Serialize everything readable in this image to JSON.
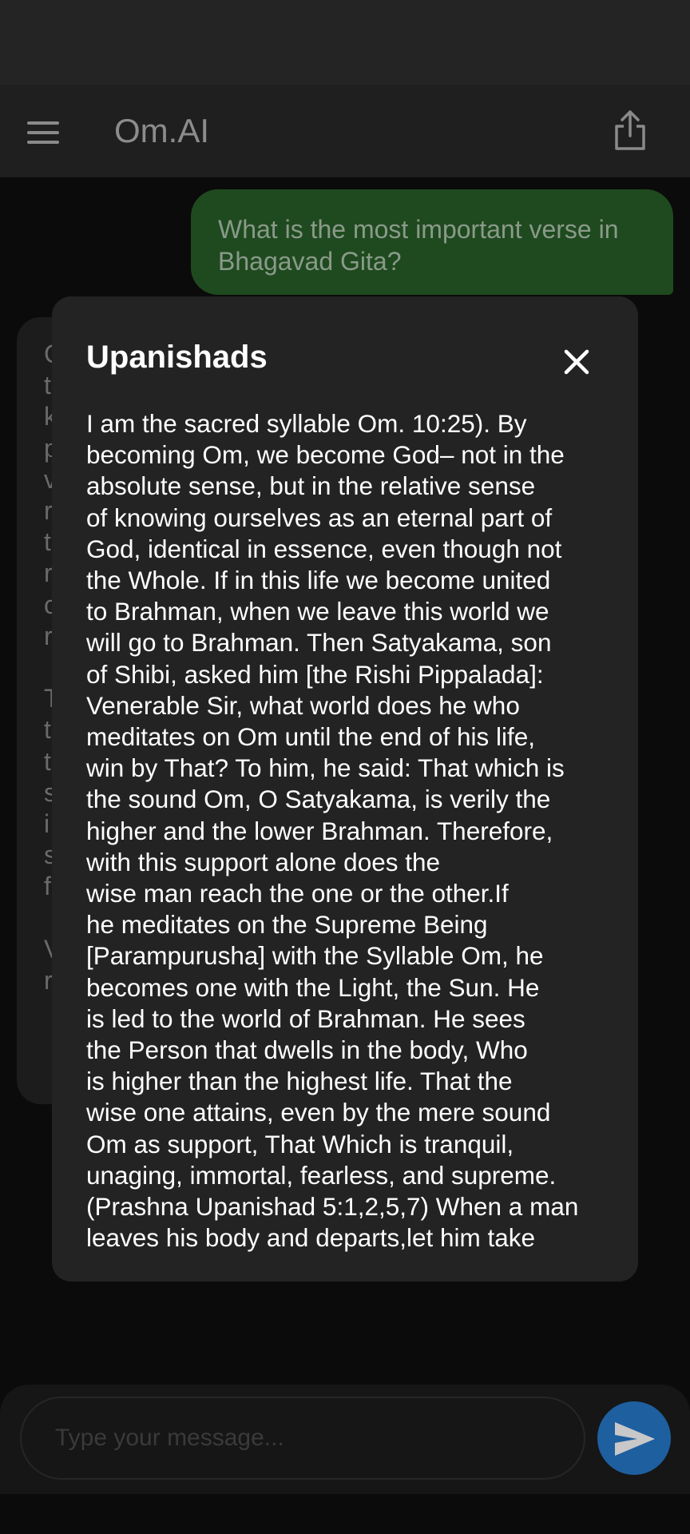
{
  "app": {
    "title": "Om.AI"
  },
  "chat": {
    "user_message": "What is the most important verse in Bhagavad Gita?",
    "bot_peek_letters": [
      "C",
      "t",
      "k",
      "p",
      "v",
      "r",
      "t",
      "r",
      "c",
      "r",
      "",
      "T",
      "t",
      "t",
      "s",
      "i",
      "s",
      "f",
      "",
      "V",
      "r"
    ]
  },
  "modal": {
    "title": "Upanishads",
    "body": "I am the sacred syllable Om. 10:25). By\nbecoming Om, we become God– not in the\nabsolute sense, but in the relative sense\nof knowing ourselves as an eternal part of\nGod, identical in essence, even though not\nthe Whole. If in this life we become united\nto Brahman, when we leave this world we\nwill go to Brahman. Then Satyakama, son\nof Shibi, asked him [the Rishi Pippalada]:\nVenerable Sir, what world does he who\nmeditates on Om until the end of his life,\nwin by That? To him, he said: That which is\nthe sound Om, O Satyakama, is verily the\nhigher and the lower Brahman. Therefore,\nwith this support alone does the\nwise man reach the one or the other.If\nhe meditates on the Supreme Being\n[Parampurusha] with the Syllable Om, he\nbecomes one with the Light, the Sun. He\nis led to the world of Brahman. He sees\nthe Person that dwells in the body, Who\nis higher than the highest life. That the\nwise one attains, even by the mere sound\nOm as support, That Which is tranquil,\nunaging, immortal, fearless, and supreme.\n(Prashna Upanishad 5:1,2,5,7) When a man\nleaves his body and departs,let him take"
  },
  "composer": {
    "placeholder": "Type your message..."
  },
  "icons": {
    "menu": "menu-icon",
    "share": "share-icon",
    "close": "close-icon",
    "send": "send-icon"
  },
  "colors": {
    "user_bubble": "#1f4a1f",
    "modal_bg": "#232323",
    "send_button": "#1e5fa0"
  }
}
